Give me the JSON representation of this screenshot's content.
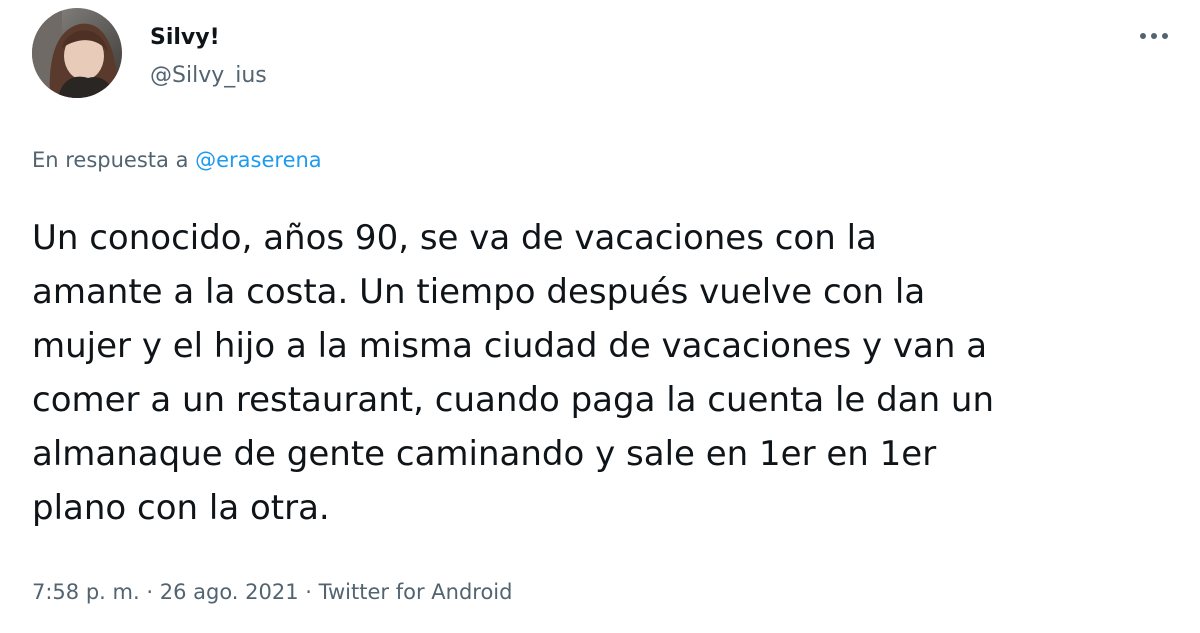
{
  "author": {
    "display_name": "Silvy!",
    "handle": "@Silvy_ius"
  },
  "reply": {
    "prefix": "En respuesta a",
    "mention": "@eraserena"
  },
  "tweet": {
    "lines": [
      "Un conocido, años 90, se va de vacaciones con la",
      "amante a la costa. Un tiempo después vuelve con la",
      "mujer y el hijo a la misma ciudad de vacaciones y van a",
      "comer a un restaurant, cuando paga la cuenta le dan un",
      "almanaque de gente caminando y sale en 1er en 1er",
      "plano con la otra."
    ]
  },
  "meta": {
    "time": "7:58 p. m.",
    "separator": "·",
    "date": "26 ago. 2021",
    "source": "Twitter for Android"
  },
  "icons": {
    "more": "more-dots-icon",
    "avatar": "profile-photo"
  },
  "colors": {
    "text_primary": "#0f1419",
    "text_secondary": "#536471",
    "link": "#1d9bf0"
  }
}
